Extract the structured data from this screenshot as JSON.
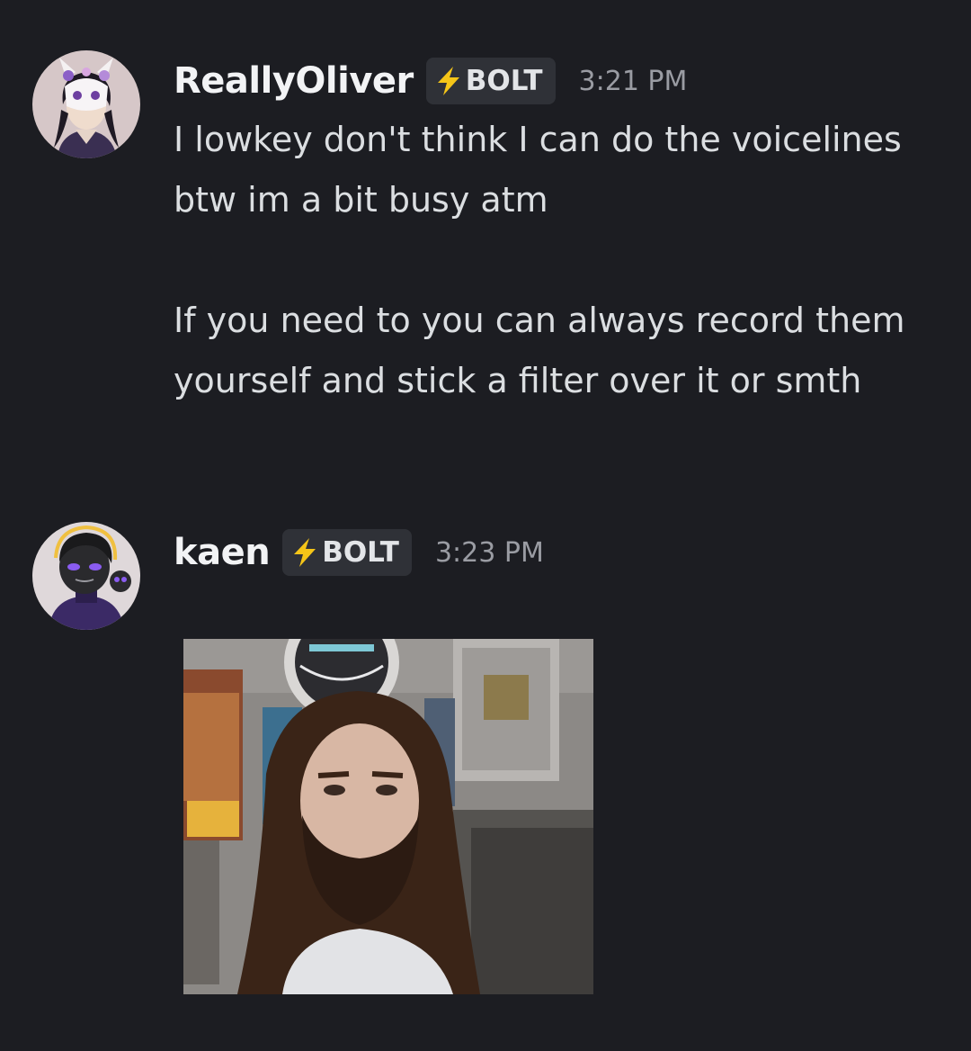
{
  "messages": [
    {
      "author": "ReallyOliver",
      "tag": "BOLT",
      "timestamp": "3:21 PM",
      "lines": [
        "I lowkey don't think I can do the voicelines btw im a bit busy atm",
        "If you need to you can always record them yourself and stick a filter over it or smth"
      ]
    },
    {
      "author": "kaen",
      "tag": "BOLT",
      "timestamp": "3:23 PM"
    }
  ],
  "colors": {
    "background": "#1c1d22",
    "tag_background": "#2f3137",
    "bolt": "#f5c518",
    "text": "#dbdee1",
    "muted": "#9a9ca3"
  },
  "icons": {
    "tag_icon": "lightning-bolt-icon"
  }
}
